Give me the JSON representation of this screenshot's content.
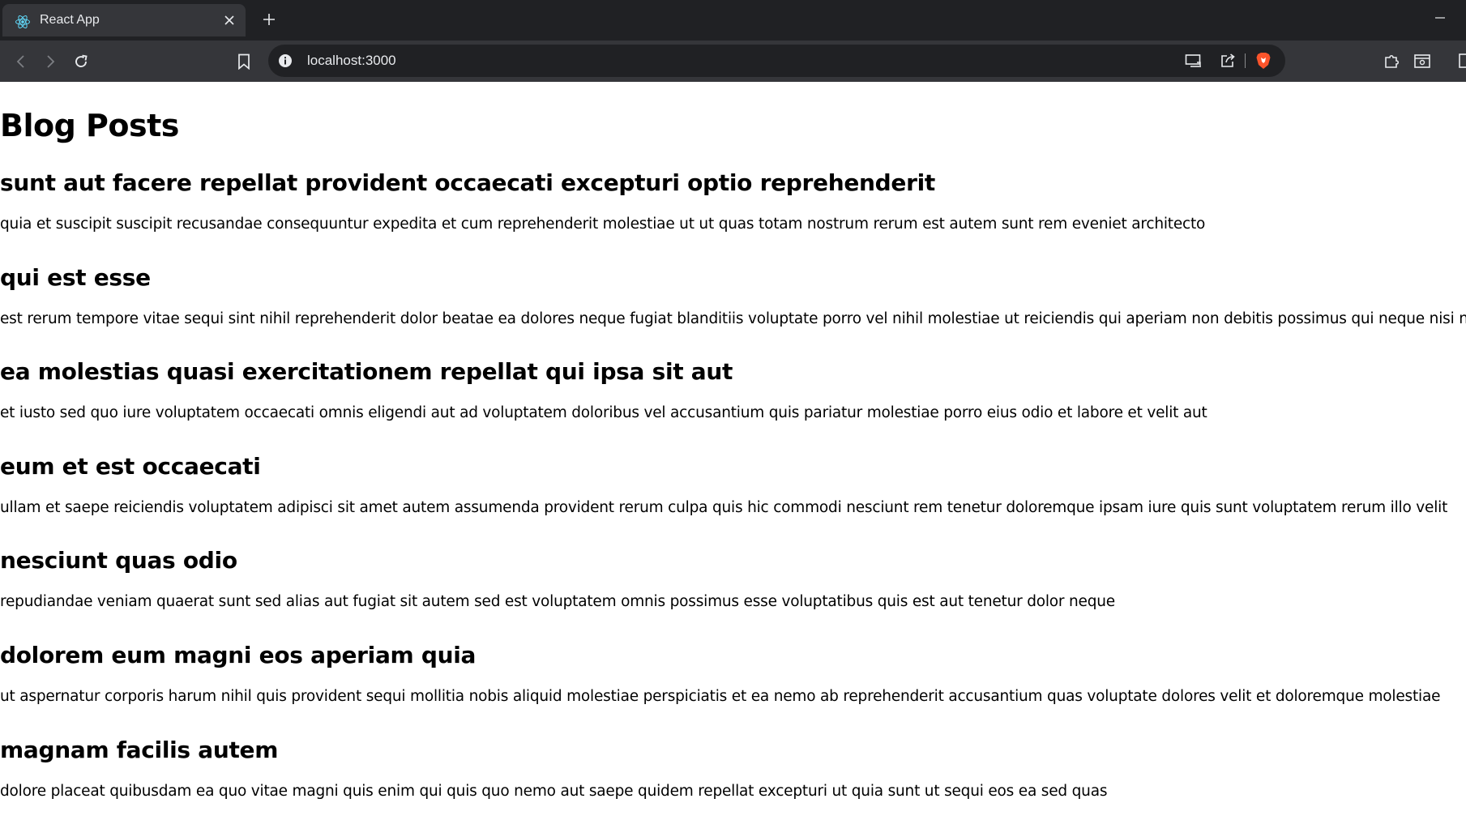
{
  "browser": {
    "tab_title": "React App",
    "url": "localhost:3000"
  },
  "page": {
    "title": "Blog Posts",
    "posts": [
      {
        "title": "sunt aut facere repellat provident occaecati excepturi optio reprehenderit",
        "body": "quia et suscipit suscipit recusandae consequuntur expedita et cum reprehenderit molestiae ut ut quas totam nostrum rerum est autem sunt rem eveniet architecto"
      },
      {
        "title": "qui est esse",
        "body": "est rerum tempore vitae sequi sint nihil reprehenderit dolor beatae ea dolores neque fugiat blanditiis voluptate porro vel nihil molestiae ut reiciendis qui aperiam non debitis possimus qui neque nisi nulla"
      },
      {
        "title": "ea molestias quasi exercitationem repellat qui ipsa sit aut",
        "body": "et iusto sed quo iure voluptatem occaecati omnis eligendi aut ad voluptatem doloribus vel accusantium quis pariatur molestiae porro eius odio et labore et velit aut"
      },
      {
        "title": "eum et est occaecati",
        "body": "ullam et saepe reiciendis voluptatem adipisci sit amet autem assumenda provident rerum culpa quis hic commodi nesciunt rem tenetur doloremque ipsam iure quis sunt voluptatem rerum illo velit"
      },
      {
        "title": "nesciunt quas odio",
        "body": "repudiandae veniam quaerat sunt sed alias aut fugiat sit autem sed est voluptatem omnis possimus esse voluptatibus quis est aut tenetur dolor neque"
      },
      {
        "title": "dolorem eum magni eos aperiam quia",
        "body": "ut aspernatur corporis harum nihil quis provident sequi mollitia nobis aliquid molestiae perspiciatis et ea nemo ab reprehenderit accusantium quas voluptate dolores velit et doloremque molestiae"
      },
      {
        "title": "magnam facilis autem",
        "body": "dolore placeat quibusdam ea quo vitae magni quis enim qui quis quo nemo aut saepe quidem repellat excepturi ut quia sunt ut sequi eos ea sed quas"
      }
    ]
  },
  "colors": {
    "chrome_bg": "#202124",
    "toolbar_bg": "#35363a",
    "brave_orange": "#fb542b",
    "react_blue": "#61dafb"
  }
}
